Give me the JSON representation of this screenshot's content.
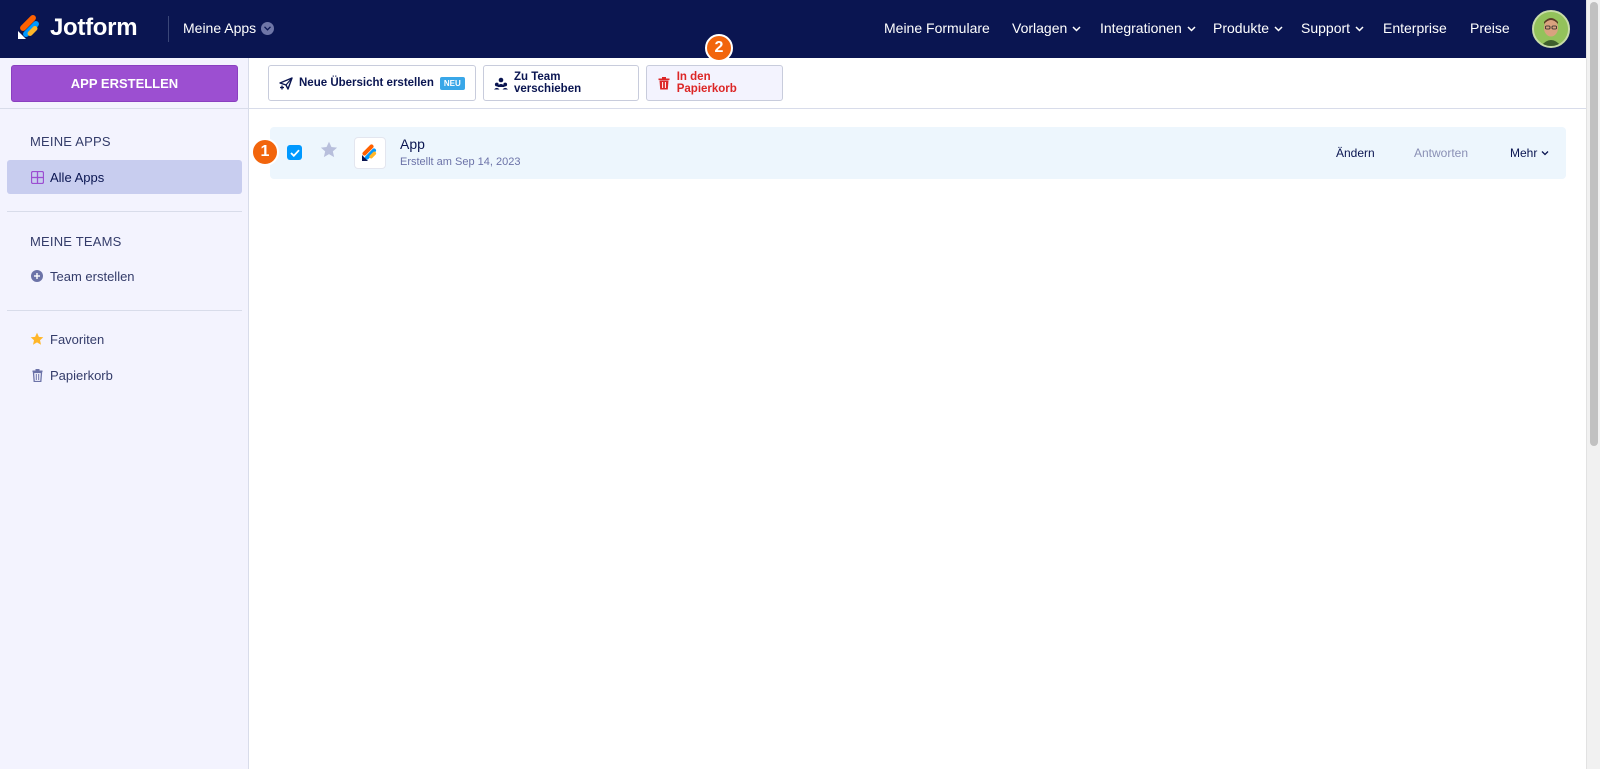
{
  "header": {
    "brand": "Jotform",
    "workspace_dropdown": "Meine Apps",
    "nav": [
      {
        "label": "Meine Formulare",
        "has_dropdown": false
      },
      {
        "label": "Vorlagen",
        "has_dropdown": true
      },
      {
        "label": "Integrationen",
        "has_dropdown": true
      },
      {
        "label": "Produkte",
        "has_dropdown": true
      },
      {
        "label": "Support",
        "has_dropdown": true
      },
      {
        "label": "Enterprise",
        "has_dropdown": false
      },
      {
        "label": "Preise",
        "has_dropdown": false
      }
    ],
    "avatar_icon": "user-avatar"
  },
  "sidebar": {
    "create_button": "APP ERSTELLEN",
    "apps_heading": "MEINE APPS",
    "all_apps": "Alle Apps",
    "teams_heading": "MEINE TEAMS",
    "create_team": "Team erstellen",
    "favorites": "Favoriten",
    "trash": "Papierkorb"
  },
  "toolbar": {
    "new_overview": "Neue Übersicht erstellen",
    "new_badge": "NEU",
    "move_to_team": "Zu Team verschieben",
    "move_to_trash": "In den Papierkorb"
  },
  "markers": [
    "1",
    "2"
  ],
  "apps": [
    {
      "title": "App",
      "subtitle": "Erstellt am Sep 14, 2023",
      "checked": true,
      "favorite": false,
      "actions": {
        "edit": "Ändern",
        "responses": "Antworten",
        "more": "Mehr"
      }
    }
  ],
  "colors": {
    "topbar": "#0a1551",
    "create_button": "#9c4fd1",
    "danger": "#dc2626",
    "marker": "#f2650c",
    "checkbox": "#0099ff"
  }
}
